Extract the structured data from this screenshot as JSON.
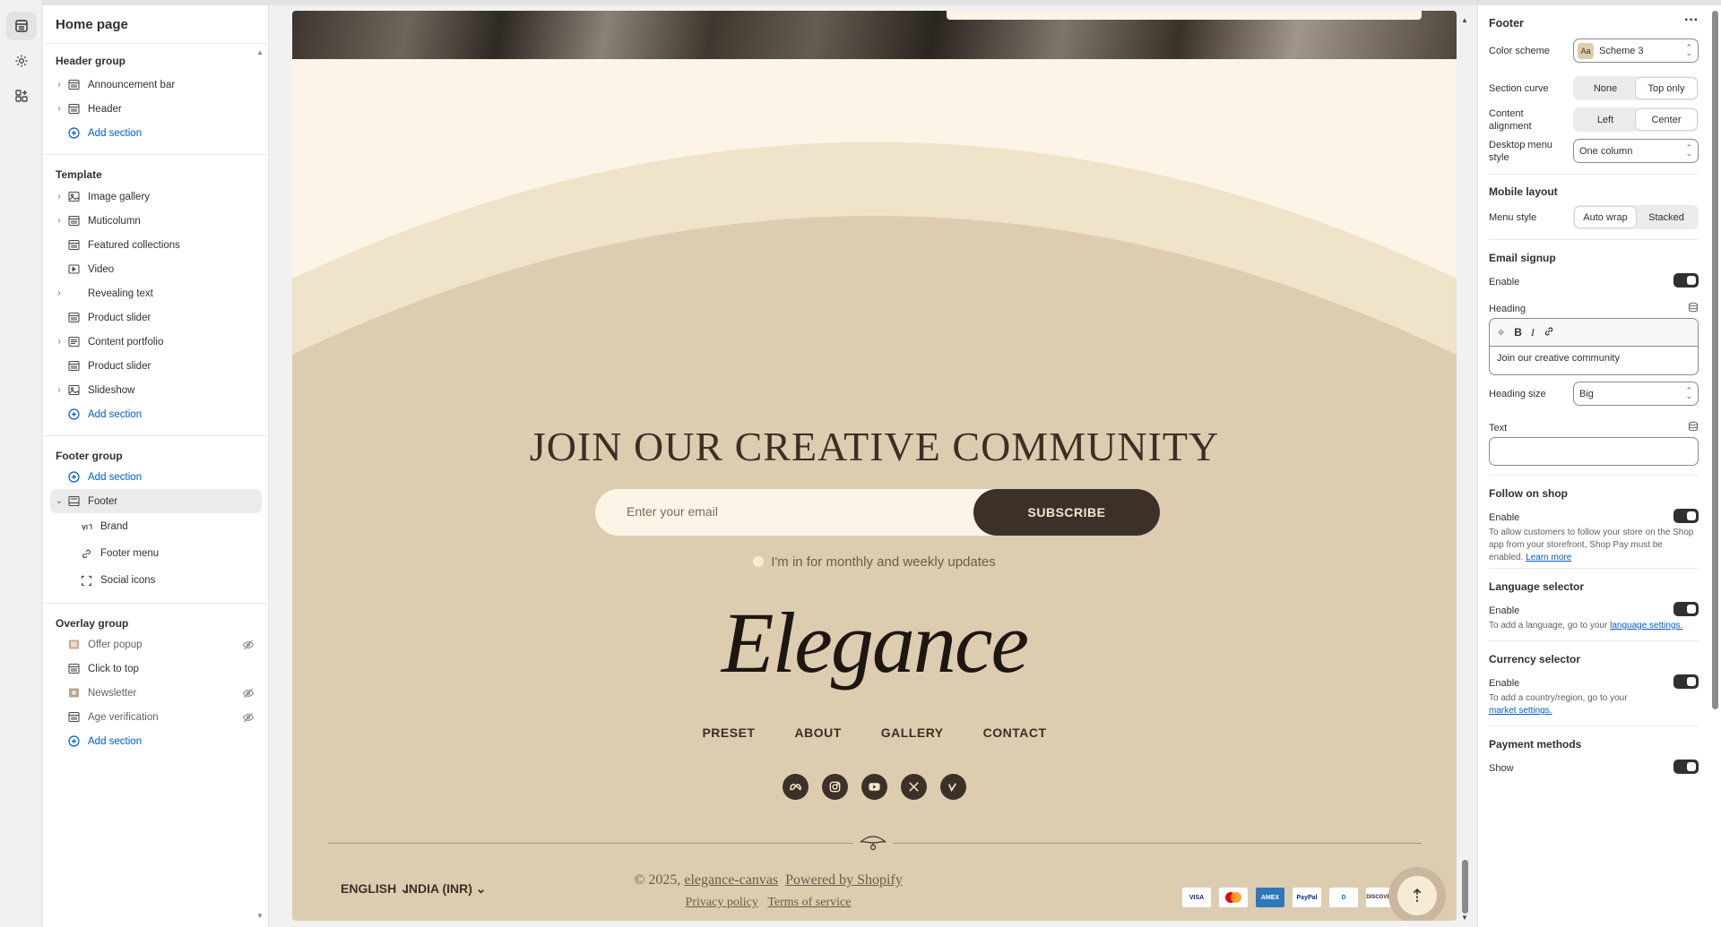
{
  "left_panel": {
    "title": "Home page",
    "header_group": {
      "title": "Header group",
      "items": [
        "Announcement bar",
        "Header"
      ],
      "add": "Add section"
    },
    "template": {
      "title": "Template",
      "items": [
        "Image gallery",
        "Muticolumn",
        "Featured collections",
        "Video",
        "Revealing text",
        "Product slider",
        "Content portfolio",
        "Product slider",
        "Slideshow"
      ],
      "add": "Add section"
    },
    "footer_group": {
      "title": "Footer group",
      "add": "Add section",
      "footer": "Footer",
      "blocks": [
        "Brand",
        "Footer menu",
        "Social icons"
      ]
    },
    "overlay_group": {
      "title": "Overlay group",
      "items": [
        "Offer popup",
        "Click to top",
        "Newsletter",
        "Age verification"
      ],
      "add": "Add section"
    }
  },
  "preview": {
    "heading": "JOIN OUR CREATIVE COMMUNITY",
    "email_placeholder": "Enter your email",
    "subscribe": "SUBSCRIBE",
    "updates": "I'm in for monthly and weekly updates",
    "brand": "Elegance",
    "menu": [
      "PRESET",
      "ABOUT",
      "GALLERY",
      "CONTACT"
    ],
    "social": [
      "meta-icon",
      "instagram-icon",
      "youtube-icon",
      "x-icon",
      "vimeo-icon"
    ],
    "language": "ENGLISH",
    "currency": "INDIA (INR)",
    "copyright_prefix": "© 2025,",
    "store_link": "elegance-canvas",
    "powered": "Powered by Shopify",
    "privacy": "Privacy policy",
    "terms": "Terms of service",
    "payments": [
      "VISA",
      "MC",
      "AMEX",
      "PayPal",
      "D",
      "DISCOVER"
    ],
    "colors": {
      "bg": "#fcf5e7",
      "footer_bg": "#ddcdb0",
      "dark": "#3b3128"
    }
  },
  "settings": {
    "title": "Footer",
    "color_scheme": {
      "label": "Color scheme",
      "value": "Scheme 3",
      "swatch": "Aa"
    },
    "section_curve": {
      "label": "Section curve",
      "options": [
        "None",
        "Top only"
      ],
      "selected": "Top only"
    },
    "content_alignment": {
      "label": "Content alignment",
      "options": [
        "Left",
        "Center"
      ],
      "selected": "Center"
    },
    "desktop_menu_style": {
      "label": "Desktop menu style",
      "value": "One column"
    },
    "mobile_layout": {
      "title": "Mobile layout",
      "menu_style_label": "Menu style",
      "options": [
        "Auto wrap",
        "Stacked"
      ],
      "selected": "Auto wrap"
    },
    "email_signup": {
      "title": "Email signup",
      "enable": "Enable",
      "heading_label": "Heading",
      "heading_value": "Join our creative community",
      "heading_size_label": "Heading size",
      "heading_size": "Big",
      "text_label": "Text"
    },
    "follow_on_shop": {
      "title": "Follow on shop",
      "enable": "Enable",
      "help": "To allow customers to follow your store on the Shop app from your storefront, Shop Pay must be enabled.",
      "link": "Learn more"
    },
    "language_selector": {
      "title": "Language selector",
      "enable": "Enable",
      "help": "To add a language, go to your",
      "link": "language settings."
    },
    "currency_selector": {
      "title": "Currency selector",
      "enable": "Enable",
      "help": "To add a country/region, go to your",
      "link": "market settings."
    },
    "payment_methods": {
      "title": "Payment methods",
      "show": "Show"
    }
  }
}
